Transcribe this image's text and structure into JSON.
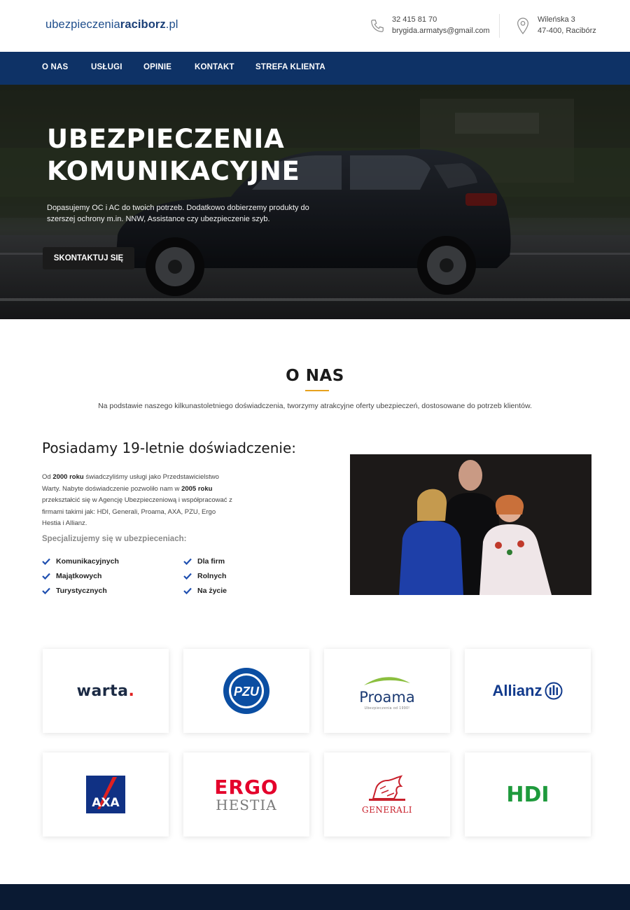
{
  "header": {
    "logo_prefix": "ubezpieczenia",
    "logo_bold": "raciborz",
    "logo_suffix": ".pl",
    "phone": "32 415 81 70",
    "email": "brygida.armatys@gmail.com",
    "address_line1": "Wileńska 3",
    "address_line2": "47-400, Racibórz",
    "phone_icon": "phone-icon",
    "location_icon": "map-pin-icon"
  },
  "nav": {
    "items": [
      "O NAS",
      "USŁUGI",
      "OPINIE",
      "KONTAKT",
      "STREFA KLIENTA"
    ]
  },
  "hero": {
    "title_line1": "UBEZPIECZENIA",
    "title_line2": "KOMUNIKACYJNE",
    "description": "Dopasujemy OC i AC do twoich potrzeb. Dodatkowo dobierzemy produkty do szerszej ochrony m.in. NNW, Assistance czy ubezpieczenie szyb.",
    "cta": "SKONTAKTUJ SIĘ"
  },
  "about": {
    "title": "O NAS",
    "subtitle": "Na podstawie naszego kilkunastoletniego doświadczenia, tworzymy atrakcyjne oferty ubezpieczeń, dostosowane do potrzeb klientów.",
    "experience_title": "Posiadamy 19-letnie doświadczenie:",
    "text_1": "Od ",
    "year_1": "2000 roku",
    "text_2": " świadczyliśmy usługi jako Przedstawicielstwo Warty. Nabyte doświadczenie pozwoliło nam w ",
    "year_2": "2005 roku",
    "text_3": " przekształcić się w Agencję Ubezpieczeniową i współpracować z firmami takimi jak: HDI, Generali, Proama, AXA, PZU, Ergo Hestia i Allianz.",
    "specialization_title": "Specjalizujemy się w ubezpieceniach:",
    "specializations": [
      "Komunikacyjnych",
      "Majątkowych",
      "Turystycznych",
      "Dla firm",
      "Rolnych",
      "Na życie"
    ]
  },
  "partners": {
    "warta": "warta",
    "warta_dot": ".",
    "pzu": "PZU",
    "proama": "Proama",
    "proama_tag": "Ubezpieczenia od 1990!",
    "allianz": "Allianz",
    "axa": "AXA",
    "ergo": "ERGO",
    "hestia": "HESTIA",
    "generali": "GENERALI",
    "hdi": "HDI"
  },
  "colors": {
    "nav_bg": "#0e3266",
    "accent": "#e7a21e",
    "check": "#1f4fb0",
    "footer_bg": "#0a1a33"
  }
}
